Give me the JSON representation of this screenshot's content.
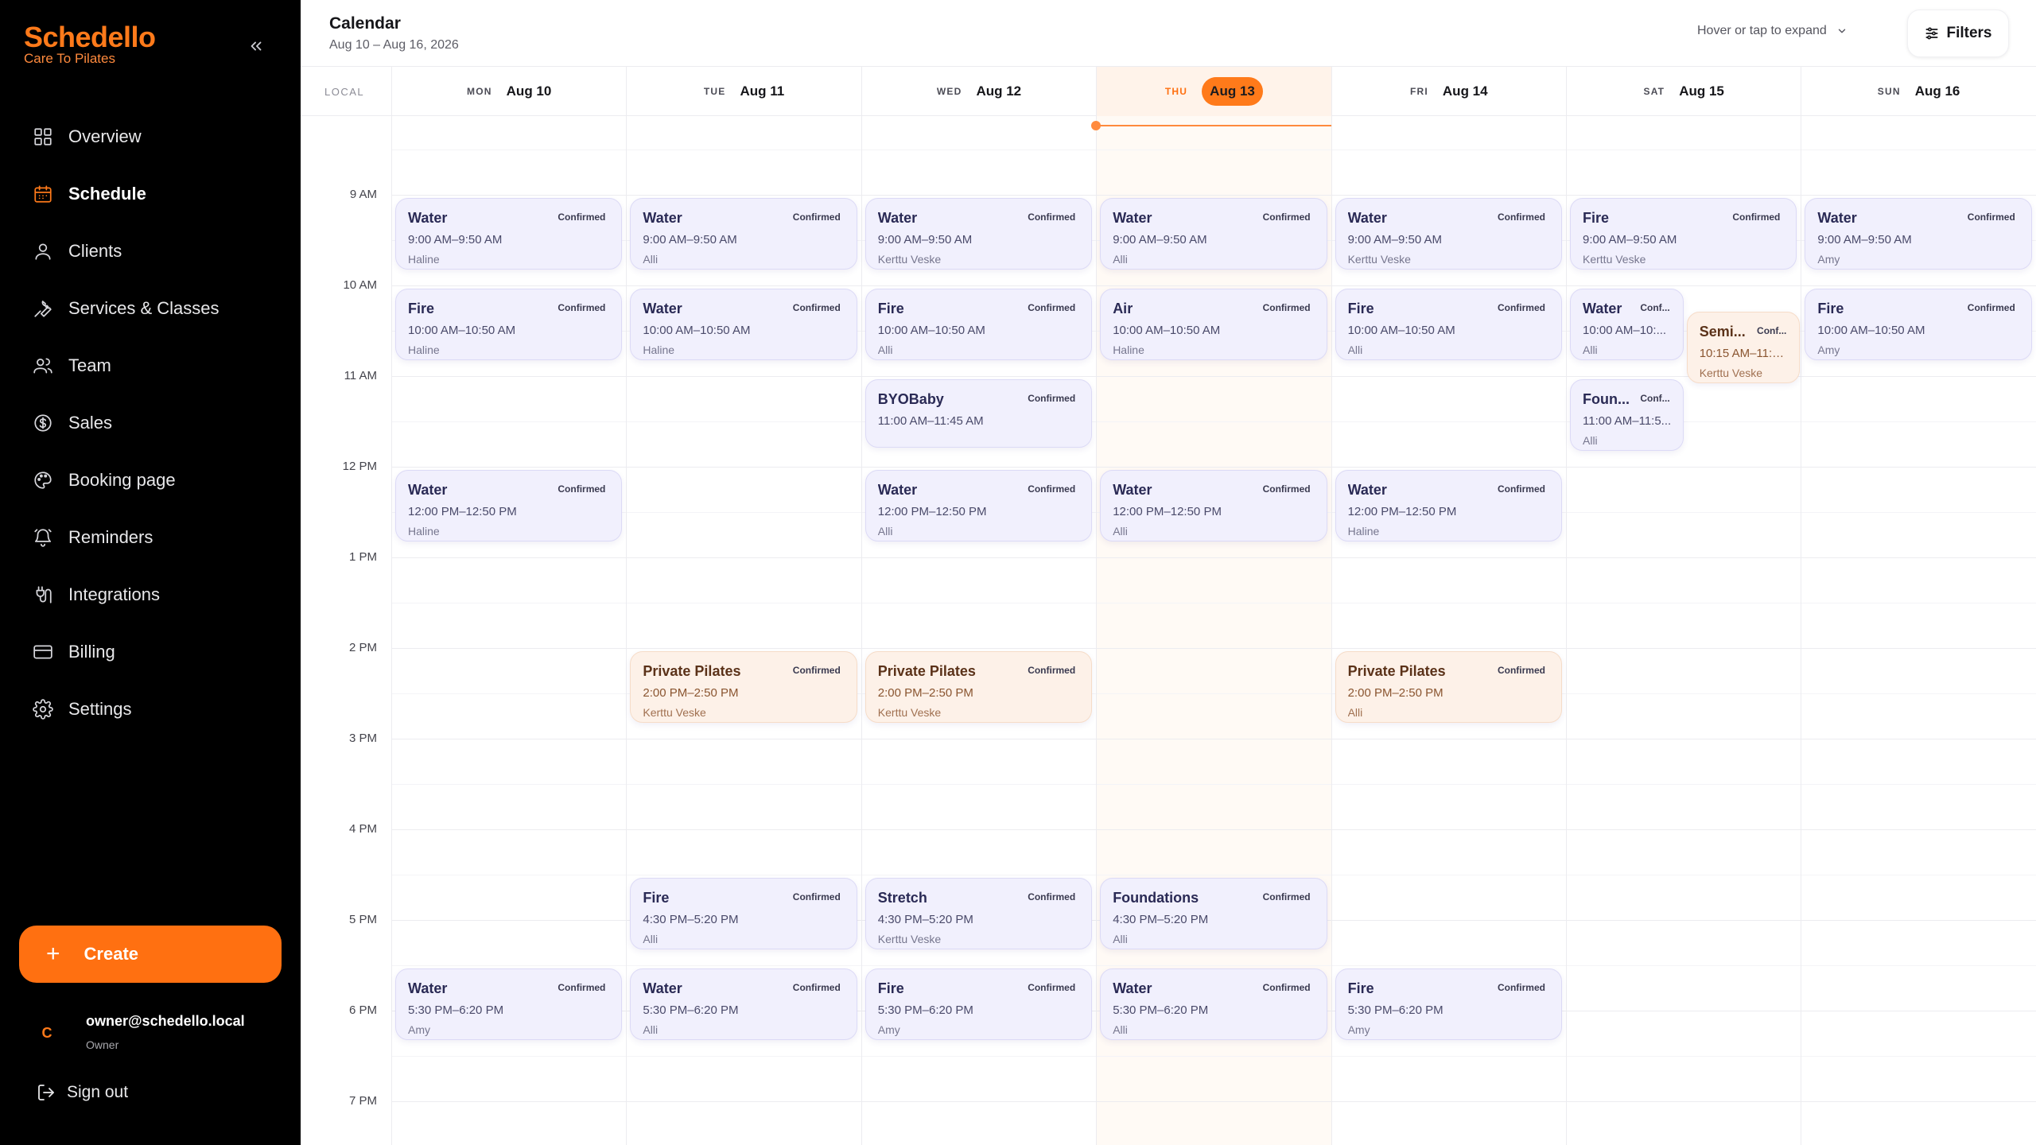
{
  "brand": {
    "name": "Schedello",
    "subtitle": "Care To Pilates"
  },
  "nav": [
    {
      "label": "Overview",
      "icon": "grid-icon",
      "active": false
    },
    {
      "label": "Schedule",
      "icon": "calendar-icon",
      "active": true
    },
    {
      "label": "Clients",
      "icon": "user-icon",
      "active": false
    },
    {
      "label": "Services & Classes",
      "icon": "wrench-icon",
      "active": false
    },
    {
      "label": "Team",
      "icon": "users-icon",
      "active": false
    },
    {
      "label": "Sales",
      "icon": "dollar-icon",
      "active": false
    },
    {
      "label": "Booking page",
      "icon": "palette-icon",
      "active": false
    },
    {
      "label": "Reminders",
      "icon": "bell-icon",
      "active": false
    },
    {
      "label": "Integrations",
      "icon": "plug-icon",
      "active": false
    },
    {
      "label": "Billing",
      "icon": "card-icon",
      "active": false
    },
    {
      "label": "Settings",
      "icon": "gear-icon",
      "active": false
    }
  ],
  "create_label": "Create",
  "user": {
    "initial": "C",
    "email": "owner@schedello.local",
    "role": "Owner"
  },
  "signout_label": "Sign out",
  "header": {
    "title": "Calendar",
    "range": "Aug 10 – Aug 16, 2026",
    "expand_hint": "Hover or tap to expand",
    "filters_label": "Filters"
  },
  "colors": {
    "accent": "#ff7011",
    "event_purple": "#f1f0fd",
    "event_peach": "#fdf1e8"
  },
  "timezone_label": "LOCAL",
  "days": [
    {
      "dow": "MON",
      "date": "Aug 10",
      "today": false
    },
    {
      "dow": "TUE",
      "date": "Aug 11",
      "today": false
    },
    {
      "dow": "WED",
      "date": "Aug 12",
      "today": false
    },
    {
      "dow": "THU",
      "date": "Aug 13",
      "today": true
    },
    {
      "dow": "FRI",
      "date": "Aug 14",
      "today": false
    },
    {
      "dow": "SAT",
      "date": "Aug 15",
      "today": false
    },
    {
      "dow": "SUN",
      "date": "Aug 16",
      "today": false
    }
  ],
  "hours": [
    "9 AM",
    "10 AM",
    "11 AM",
    "12 PM",
    "1 PM",
    "2 PM",
    "3 PM",
    "4 PM",
    "5 PM",
    "6 PM",
    "7 PM"
  ],
  "events": [
    {
      "day": 0,
      "start": "09:00",
      "end": "09:50",
      "title": "Water",
      "time": "9:00 AM–9:50 AM",
      "instructor": "Haline",
      "status": "Confirmed",
      "color": "purple"
    },
    {
      "day": 1,
      "start": "09:00",
      "end": "09:50",
      "title": "Water",
      "time": "9:00 AM–9:50 AM",
      "instructor": "Alli",
      "status": "Confirmed",
      "color": "purple"
    },
    {
      "day": 2,
      "start": "09:00",
      "end": "09:50",
      "title": "Water",
      "time": "9:00 AM–9:50 AM",
      "instructor": "Kerttu Veske",
      "status": "Confirmed",
      "color": "purple"
    },
    {
      "day": 3,
      "start": "09:00",
      "end": "09:50",
      "title": "Water",
      "time": "9:00 AM–9:50 AM",
      "instructor": "Alli",
      "status": "Confirmed",
      "color": "purple"
    },
    {
      "day": 4,
      "start": "09:00",
      "end": "09:50",
      "title": "Water",
      "time": "9:00 AM–9:50 AM",
      "instructor": "Kerttu Veske",
      "status": "Confirmed",
      "color": "purple"
    },
    {
      "day": 5,
      "start": "09:00",
      "end": "09:50",
      "title": "Fire",
      "time": "9:00 AM–9:50 AM",
      "instructor": "Kerttu Veske",
      "status": "Confirmed",
      "color": "purple"
    },
    {
      "day": 6,
      "start": "09:00",
      "end": "09:50",
      "title": "Water",
      "time": "9:00 AM–9:50 AM",
      "instructor": "Amy",
      "status": "Confirmed",
      "color": "purple"
    },
    {
      "day": 0,
      "start": "10:00",
      "end": "10:50",
      "title": "Fire",
      "time": "10:00 AM–10:50 AM",
      "instructor": "Haline",
      "status": "Confirmed",
      "color": "purple"
    },
    {
      "day": 1,
      "start": "10:00",
      "end": "10:50",
      "title": "Water",
      "time": "10:00 AM–10:50 AM",
      "instructor": "Haline",
      "status": "Confirmed",
      "color": "purple"
    },
    {
      "day": 2,
      "start": "10:00",
      "end": "10:50",
      "title": "Fire",
      "time": "10:00 AM–10:50 AM",
      "instructor": "Alli",
      "status": "Confirmed",
      "color": "purple"
    },
    {
      "day": 3,
      "start": "10:00",
      "end": "10:50",
      "title": "Air",
      "time": "10:00 AM–10:50 AM",
      "instructor": "Haline",
      "status": "Confirmed",
      "color": "purple"
    },
    {
      "day": 4,
      "start": "10:00",
      "end": "10:50",
      "title": "Fire",
      "time": "10:00 AM–10:50 AM",
      "instructor": "Alli",
      "status": "Confirmed",
      "color": "purple"
    },
    {
      "day": 5,
      "start": "10:00",
      "end": "10:50",
      "title": "Water",
      "time": "10:00 AM–10:...",
      "instructor": "Alli",
      "status": "Conf...",
      "color": "purple",
      "lane": 0,
      "lanes": 2
    },
    {
      "day": 5,
      "start": "10:15",
      "end": "11:05",
      "title": "Semi...",
      "time": "10:15 AM–11:0...",
      "instructor": "Kerttu Veske",
      "status": "Conf...",
      "color": "peach",
      "lane": 1,
      "lanes": 2
    },
    {
      "day": 6,
      "start": "10:00",
      "end": "10:50",
      "title": "Fire",
      "time": "10:00 AM–10:50 AM",
      "instructor": "Amy",
      "status": "Confirmed",
      "color": "purple"
    },
    {
      "day": 2,
      "start": "11:00",
      "end": "11:45",
      "title": "BYOBaby",
      "time": "11:00 AM–11:45 AM",
      "instructor": "",
      "status": "Confirmed",
      "color": "purple"
    },
    {
      "day": 5,
      "start": "11:00",
      "end": "11:50",
      "title": "Foun...",
      "time": "11:00 AM–11:5...",
      "instructor": "Alli",
      "status": "Conf...",
      "color": "purple",
      "lane": 0,
      "lanes": 2
    },
    {
      "day": 0,
      "start": "12:00",
      "end": "12:50",
      "title": "Water",
      "time": "12:00 PM–12:50 PM",
      "instructor": "Haline",
      "status": "Confirmed",
      "color": "purple"
    },
    {
      "day": 2,
      "start": "12:00",
      "end": "12:50",
      "title": "Water",
      "time": "12:00 PM–12:50 PM",
      "instructor": "Alli",
      "status": "Confirmed",
      "color": "purple"
    },
    {
      "day": 3,
      "start": "12:00",
      "end": "12:50",
      "title": "Water",
      "time": "12:00 PM–12:50 PM",
      "instructor": "Alli",
      "status": "Confirmed",
      "color": "purple"
    },
    {
      "day": 4,
      "start": "12:00",
      "end": "12:50",
      "title": "Water",
      "time": "12:00 PM–12:50 PM",
      "instructor": "Haline",
      "status": "Confirmed",
      "color": "purple"
    },
    {
      "day": 1,
      "start": "14:00",
      "end": "14:50",
      "title": "Private Pilates",
      "time": "2:00 PM–2:50 PM",
      "instructor": "Kerttu Veske",
      "status": "Confirmed",
      "color": "peach"
    },
    {
      "day": 2,
      "start": "14:00",
      "end": "14:50",
      "title": "Private Pilates",
      "time": "2:00 PM–2:50 PM",
      "instructor": "Kerttu Veske",
      "status": "Confirmed",
      "color": "peach"
    },
    {
      "day": 4,
      "start": "14:00",
      "end": "14:50",
      "title": "Private Pilates",
      "time": "2:00 PM–2:50 PM",
      "instructor": "Alli",
      "status": "Confirmed",
      "color": "peach"
    },
    {
      "day": 1,
      "start": "16:30",
      "end": "17:20",
      "title": "Fire",
      "time": "4:30 PM–5:20 PM",
      "instructor": "Alli",
      "status": "Confirmed",
      "color": "purple"
    },
    {
      "day": 2,
      "start": "16:30",
      "end": "17:20",
      "title": "Stretch",
      "time": "4:30 PM–5:20 PM",
      "instructor": "Kerttu Veske",
      "status": "Confirmed",
      "color": "purple"
    },
    {
      "day": 3,
      "start": "16:30",
      "end": "17:20",
      "title": "Foundations",
      "time": "4:30 PM–5:20 PM",
      "instructor": "Alli",
      "status": "Confirmed",
      "color": "purple"
    },
    {
      "day": 0,
      "start": "17:30",
      "end": "18:20",
      "title": "Water",
      "time": "5:30 PM–6:20 PM",
      "instructor": "Amy",
      "status": "Confirmed",
      "color": "purple"
    },
    {
      "day": 1,
      "start": "17:30",
      "end": "18:20",
      "title": "Water",
      "time": "5:30 PM–6:20 PM",
      "instructor": "Alli",
      "status": "Confirmed",
      "color": "purple"
    },
    {
      "day": 2,
      "start": "17:30",
      "end": "18:20",
      "title": "Fire",
      "time": "5:30 PM–6:20 PM",
      "instructor": "Amy",
      "status": "Confirmed",
      "color": "purple"
    },
    {
      "day": 3,
      "start": "17:30",
      "end": "18:20",
      "title": "Water",
      "time": "5:30 PM–6:20 PM",
      "instructor": "Alli",
      "status": "Confirmed",
      "color": "purple"
    },
    {
      "day": 4,
      "start": "17:30",
      "end": "18:20",
      "title": "Fire",
      "time": "5:30 PM–6:20 PM",
      "instructor": "Amy",
      "status": "Confirmed",
      "color": "purple"
    }
  ]
}
